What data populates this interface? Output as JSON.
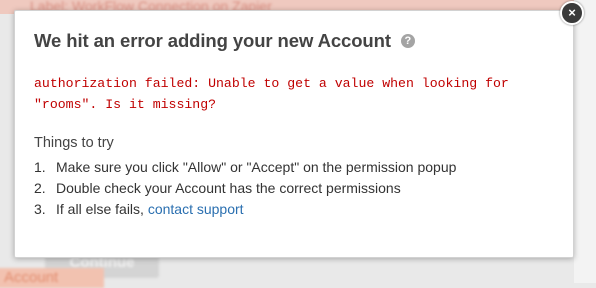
{
  "background": {
    "top_text": "Label: WorkFlow Connection on Zapier",
    "continue_button": "Continue",
    "account_link": "Account"
  },
  "modal": {
    "title": "We hit an error adding your new Account",
    "help_icon": "question-circle-icon",
    "close_icon": "close-icon",
    "close_glyph": "×",
    "error": "authorization failed: Unable to get a value when looking for\n\"rooms\". Is it missing?",
    "tips_heading": "Things to try",
    "tips": [
      {
        "num": "1.",
        "text": "Make sure you click \"Allow\" or \"Accept\" on the permission popup"
      },
      {
        "num": "2.",
        "text": "Double check your Account has the correct permissions"
      },
      {
        "num": "3.",
        "text": "If all else fails, ",
        "link": "contact support"
      }
    ]
  },
  "colors": {
    "error_text": "#c00000",
    "link": "#2a6fb0",
    "title": "#444444"
  }
}
